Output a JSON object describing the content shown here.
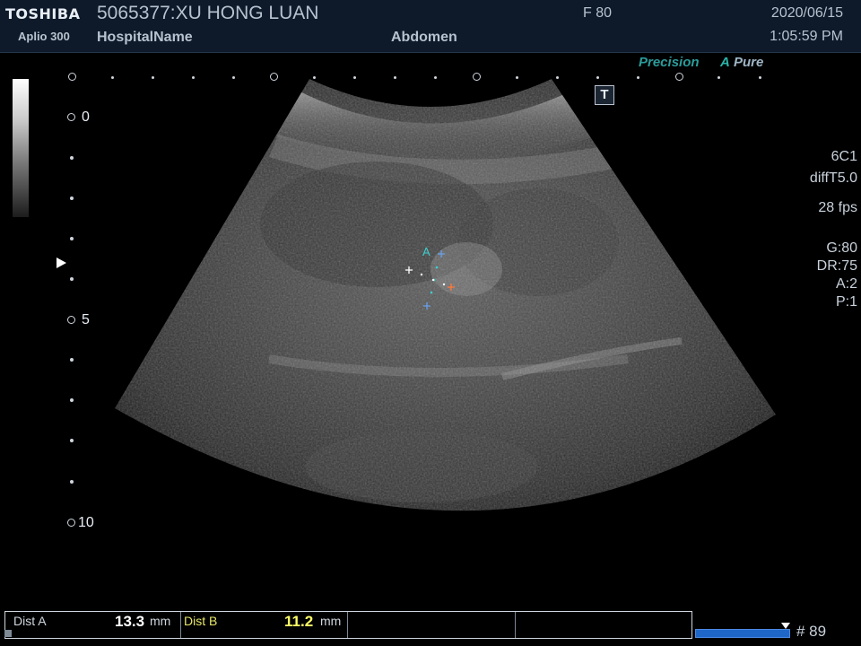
{
  "header": {
    "brand": "TOSHIBA",
    "model": "Aplio 300",
    "patient": "5065377:XU HONG LUAN",
    "hospital": "HospitalName",
    "exam": "Abdomen",
    "frame_rate_label": "F  80",
    "date": "2020/06/15",
    "time": "1:05:59 PM"
  },
  "overlay": {
    "precision": "Precision",
    "apure_a": "A",
    "apure": "Pure",
    "t_button": "T",
    "caliper_label": "A"
  },
  "depth_scale": {
    "labels": [
      "0",
      "5",
      "10"
    ]
  },
  "info_panel": {
    "probe": "6C1",
    "preset": "diffT5.0",
    "fps": "28 fps",
    "gain": "G:80",
    "dynamic_range": "DR:75",
    "a": "A:2",
    "p": "P:1"
  },
  "measurements": {
    "dist_a_label": "Dist A",
    "dist_a_value": "13.3",
    "dist_a_unit": "mm",
    "dist_b_label": "Dist B",
    "dist_b_value": "11.2",
    "dist_b_unit": "mm"
  },
  "cine": {
    "frame_count": "# 89"
  },
  "colors": {
    "caliper_a": "#3fd0d0",
    "caliper_b": "#ffffff",
    "measure_value": "#ffffff",
    "measure_value_b": "#ffff66",
    "accent_teal": "#2b9c9a"
  }
}
